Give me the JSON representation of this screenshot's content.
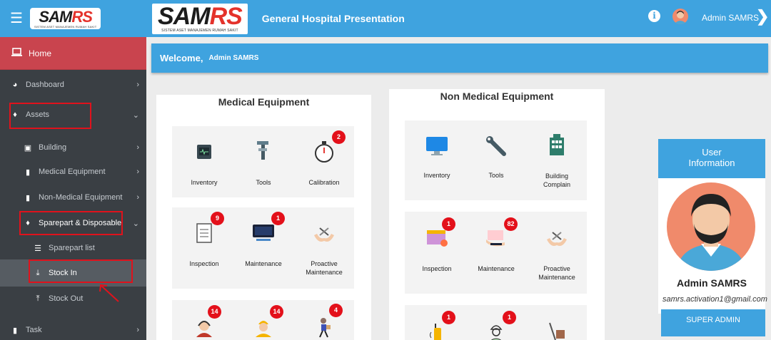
{
  "brand": {
    "word_main": "SAM",
    "word_accent": "RS",
    "subtitle": "SISTEM ASET MANAJEMEN RUMAH SAKIT"
  },
  "header": {
    "title": "General Hospital Presentation",
    "user_name": "Admin SAMRS"
  },
  "sidebar": {
    "home": "Home",
    "dashboard": "Dashboard",
    "assets": "Assets",
    "building": "Building",
    "medical_equipment": "Medical Equipment",
    "non_medical_equipment": "Non-Medical Equipment",
    "sparepart": "Sparepart & Disposable",
    "sparepart_list": "Sparepart list",
    "stock_in": "Stock In",
    "stock_out": "Stock Out",
    "task": "Task"
  },
  "welcome": {
    "greeting": "Welcome,",
    "name": "Admin SAMRS"
  },
  "medical": {
    "title": "Medical Equipment",
    "inventory": "Inventory",
    "tools": "Tools",
    "calibration": "Calibration",
    "calibration_badge": "2",
    "inspection": "Inspection",
    "inspection_badge": "9",
    "maintenance": "Maintenance",
    "maintenance_badge": "1",
    "proactive_1": "Proactive",
    "proactive_2": "Maintenance",
    "row3_badge_1": "14",
    "row3_badge_2": "14",
    "row3_badge_3": "4"
  },
  "nonmedical": {
    "title": "Non Medical Equipment",
    "inventory": "Inventory",
    "tools": "Tools",
    "building_1": "Building",
    "building_2": "Complain",
    "inspection": "Inspection",
    "inspection_badge": "1",
    "maintenance": "Maintenance",
    "maintenance_badge": "82",
    "proactive_1": "Proactive",
    "proactive_2": "Maintenance",
    "row3_badge_1": "1",
    "row3_badge_2": "1"
  },
  "user_info": {
    "title_1": "User",
    "title_2": "Information",
    "name": "Admin SAMRS",
    "email": "samrs.activation1@gmail.com",
    "role": "SUPER ADMIN"
  },
  "colors": {
    "primary": "#3fa3df",
    "sidebar": "#3a3f44",
    "home_active": "#c9444e",
    "badge": "#e3101a",
    "highlight": "#e0121c"
  }
}
